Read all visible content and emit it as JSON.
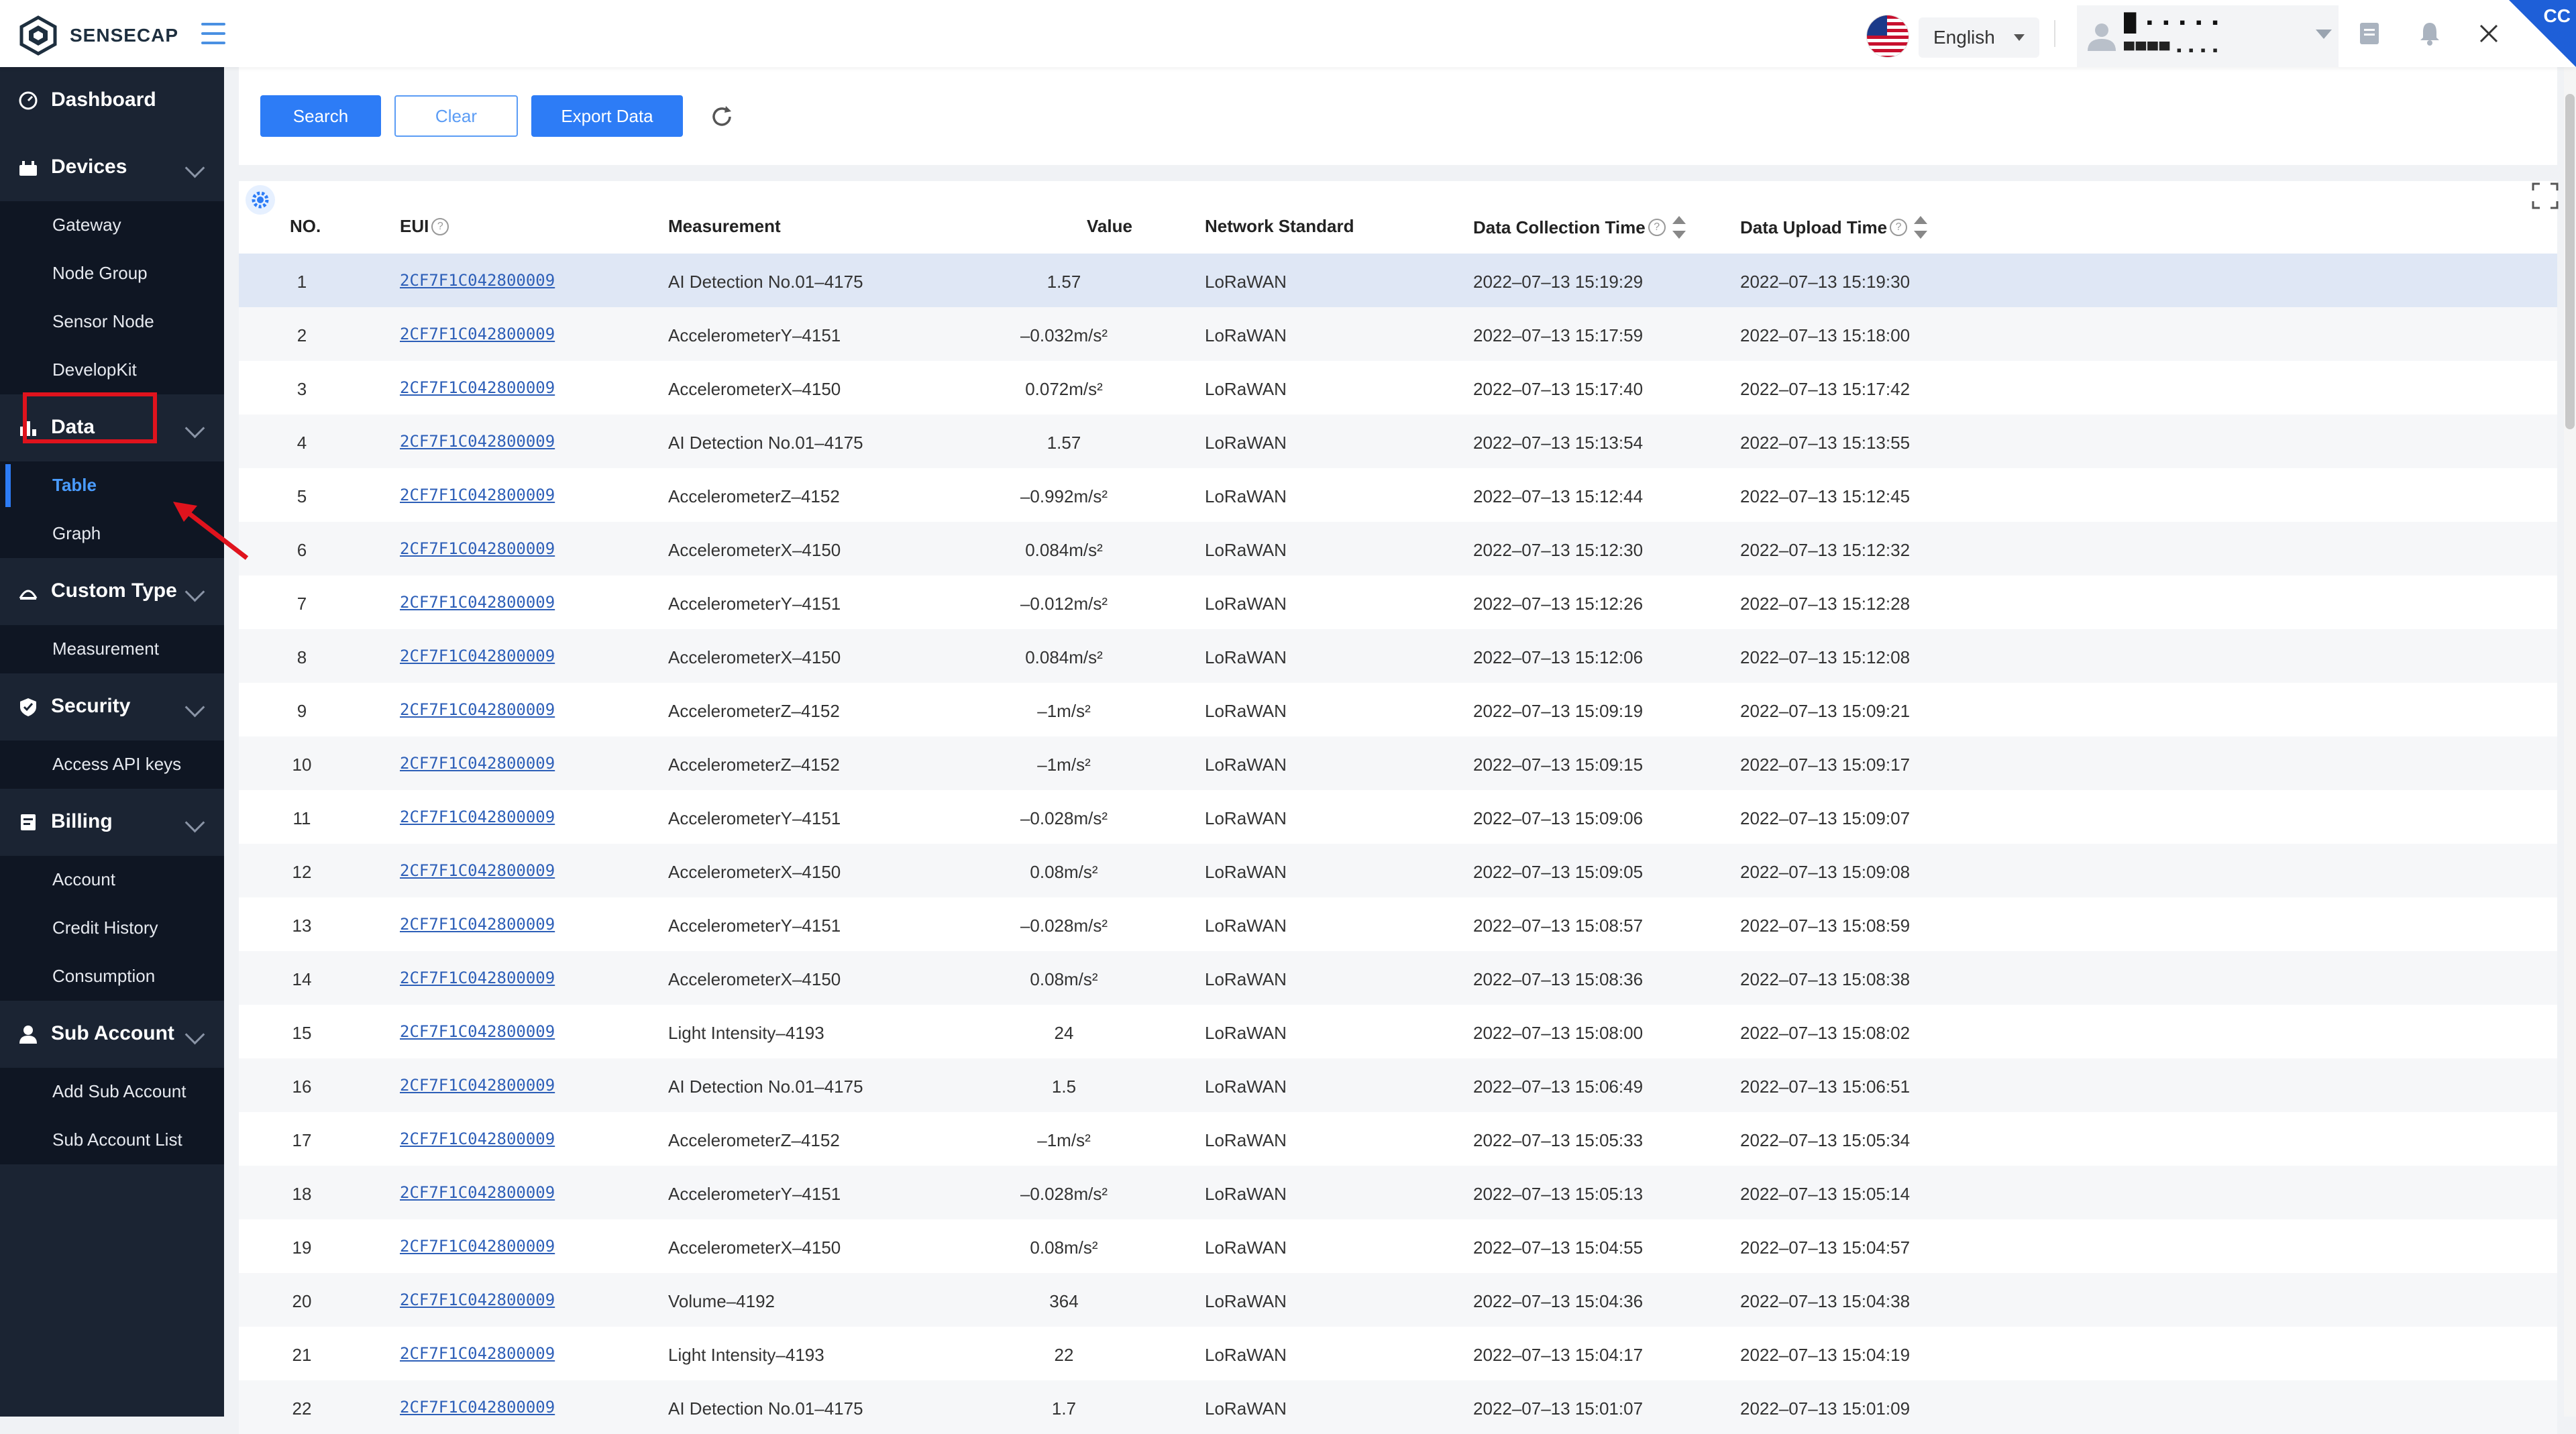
{
  "brand": {
    "name": "SENSECAP"
  },
  "header": {
    "language": "English",
    "user_name": "█ ▪ ▪ ▪ ▪ ▪",
    "user_sub": "▀▀▀▀ ▪ ▪ ▪ ▪",
    "corner_badge": "CC",
    "icons": [
      "hamburger-icon",
      "us-flag-icon",
      "document-icon",
      "bell-icon",
      "close-icon"
    ]
  },
  "sidebar": {
    "dashboard": "Dashboard",
    "devices": {
      "label": "Devices",
      "items": [
        "Gateway",
        "Node Group",
        "Sensor Node",
        "DevelopKit"
      ]
    },
    "data": {
      "label": "Data",
      "items": [
        "Table",
        "Graph"
      ],
      "active": "Table"
    },
    "custom_type": {
      "label": "Custom Type",
      "items": [
        "Measurement"
      ]
    },
    "security": {
      "label": "Security",
      "items": [
        "Access API keys"
      ]
    },
    "billing": {
      "label": "Billing",
      "items": [
        "Account",
        "Credit History",
        "Consumption"
      ]
    },
    "sub_account": {
      "label": "Sub Account",
      "items": [
        "Add Sub Account",
        "Sub Account List"
      ]
    }
  },
  "toolbar": {
    "search": "Search",
    "clear": "Clear",
    "export": "Export Data"
  },
  "table": {
    "headers": {
      "no": "NO.",
      "eui": "EUI",
      "measurement": "Measurement",
      "value": "Value",
      "network": "Network Standard",
      "collection": "Data Collection Time",
      "upload": "Data Upload Time"
    },
    "rows": [
      {
        "no": "1",
        "eui": "2CF7F1C042800009",
        "measurement": "AI Detection No.01–4175",
        "value": "1.57",
        "network": "LoRaWAN",
        "collection": "2022–07–13 15:19:29",
        "upload": "2022–07–13 15:19:30"
      },
      {
        "no": "2",
        "eui": "2CF7F1C042800009",
        "measurement": "AccelerometerY–4151",
        "value": "–0.032m/s²",
        "network": "LoRaWAN",
        "collection": "2022–07–13 15:17:59",
        "upload": "2022–07–13 15:18:00"
      },
      {
        "no": "3",
        "eui": "2CF7F1C042800009",
        "measurement": "AccelerometerX–4150",
        "value": "0.072m/s²",
        "network": "LoRaWAN",
        "collection": "2022–07–13 15:17:40",
        "upload": "2022–07–13 15:17:42"
      },
      {
        "no": "4",
        "eui": "2CF7F1C042800009",
        "measurement": "AI Detection No.01–4175",
        "value": "1.57",
        "network": "LoRaWAN",
        "collection": "2022–07–13 15:13:54",
        "upload": "2022–07–13 15:13:55"
      },
      {
        "no": "5",
        "eui": "2CF7F1C042800009",
        "measurement": "AccelerometerZ–4152",
        "value": "–0.992m/s²",
        "network": "LoRaWAN",
        "collection": "2022–07–13 15:12:44",
        "upload": "2022–07–13 15:12:45"
      },
      {
        "no": "6",
        "eui": "2CF7F1C042800009",
        "measurement": "AccelerometerX–4150",
        "value": "0.084m/s²",
        "network": "LoRaWAN",
        "collection": "2022–07–13 15:12:30",
        "upload": "2022–07–13 15:12:32"
      },
      {
        "no": "7",
        "eui": "2CF7F1C042800009",
        "measurement": "AccelerometerY–4151",
        "value": "–0.012m/s²",
        "network": "LoRaWAN",
        "collection": "2022–07–13 15:12:26",
        "upload": "2022–07–13 15:12:28"
      },
      {
        "no": "8",
        "eui": "2CF7F1C042800009",
        "measurement": "AccelerometerX–4150",
        "value": "0.084m/s²",
        "network": "LoRaWAN",
        "collection": "2022–07–13 15:12:06",
        "upload": "2022–07–13 15:12:08"
      },
      {
        "no": "9",
        "eui": "2CF7F1C042800009",
        "measurement": "AccelerometerZ–4152",
        "value": "–1m/s²",
        "network": "LoRaWAN",
        "collection": "2022–07–13 15:09:19",
        "upload": "2022–07–13 15:09:21"
      },
      {
        "no": "10",
        "eui": "2CF7F1C042800009",
        "measurement": "AccelerometerZ–4152",
        "value": "–1m/s²",
        "network": "LoRaWAN",
        "collection": "2022–07–13 15:09:15",
        "upload": "2022–07–13 15:09:17"
      },
      {
        "no": "11",
        "eui": "2CF7F1C042800009",
        "measurement": "AccelerometerY–4151",
        "value": "–0.028m/s²",
        "network": "LoRaWAN",
        "collection": "2022–07–13 15:09:06",
        "upload": "2022–07–13 15:09:07"
      },
      {
        "no": "12",
        "eui": "2CF7F1C042800009",
        "measurement": "AccelerometerX–4150",
        "value": "0.08m/s²",
        "network": "LoRaWAN",
        "collection": "2022–07–13 15:09:05",
        "upload": "2022–07–13 15:09:08"
      },
      {
        "no": "13",
        "eui": "2CF7F1C042800009",
        "measurement": "AccelerometerY–4151",
        "value": "–0.028m/s²",
        "network": "LoRaWAN",
        "collection": "2022–07–13 15:08:57",
        "upload": "2022–07–13 15:08:59"
      },
      {
        "no": "14",
        "eui": "2CF7F1C042800009",
        "measurement": "AccelerometerX–4150",
        "value": "0.08m/s²",
        "network": "LoRaWAN",
        "collection": "2022–07–13 15:08:36",
        "upload": "2022–07–13 15:08:38"
      },
      {
        "no": "15",
        "eui": "2CF7F1C042800009",
        "measurement": "Light Intensity–4193",
        "value": "24",
        "network": "LoRaWAN",
        "collection": "2022–07–13 15:08:00",
        "upload": "2022–07–13 15:08:02"
      },
      {
        "no": "16",
        "eui": "2CF7F1C042800009",
        "measurement": "AI Detection No.01–4175",
        "value": "1.5",
        "network": "LoRaWAN",
        "collection": "2022–07–13 15:06:49",
        "upload": "2022–07–13 15:06:51"
      },
      {
        "no": "17",
        "eui": "2CF7F1C042800009",
        "measurement": "AccelerometerZ–4152",
        "value": "–1m/s²",
        "network": "LoRaWAN",
        "collection": "2022–07–13 15:05:33",
        "upload": "2022–07–13 15:05:34"
      },
      {
        "no": "18",
        "eui": "2CF7F1C042800009",
        "measurement": "AccelerometerY–4151",
        "value": "–0.028m/s²",
        "network": "LoRaWAN",
        "collection": "2022–07–13 15:05:13",
        "upload": "2022–07–13 15:05:14"
      },
      {
        "no": "19",
        "eui": "2CF7F1C042800009",
        "measurement": "AccelerometerX–4150",
        "value": "0.08m/s²",
        "network": "LoRaWAN",
        "collection": "2022–07–13 15:04:55",
        "upload": "2022–07–13 15:04:57"
      },
      {
        "no": "20",
        "eui": "2CF7F1C042800009",
        "measurement": "Volume–4192",
        "value": "364",
        "network": "LoRaWAN",
        "collection": "2022–07–13 15:04:36",
        "upload": "2022–07–13 15:04:38"
      },
      {
        "no": "21",
        "eui": "2CF7F1C042800009",
        "measurement": "Light Intensity–4193",
        "value": "22",
        "network": "LoRaWAN",
        "collection": "2022–07–13 15:04:17",
        "upload": "2022–07–13 15:04:19"
      },
      {
        "no": "22",
        "eui": "2CF7F1C042800009",
        "measurement": "AI Detection No.01–4175",
        "value": "1.7",
        "network": "LoRaWAN",
        "collection": "2022–07–13 15:01:07",
        "upload": "2022–07–13 15:01:09"
      }
    ]
  },
  "colors": {
    "primary": "#2d7cf6",
    "sidebar": "#1b2433",
    "sidebar_sub": "#0f1623",
    "highlight": "#e0131d",
    "selected_row": "#dfe7f5"
  }
}
